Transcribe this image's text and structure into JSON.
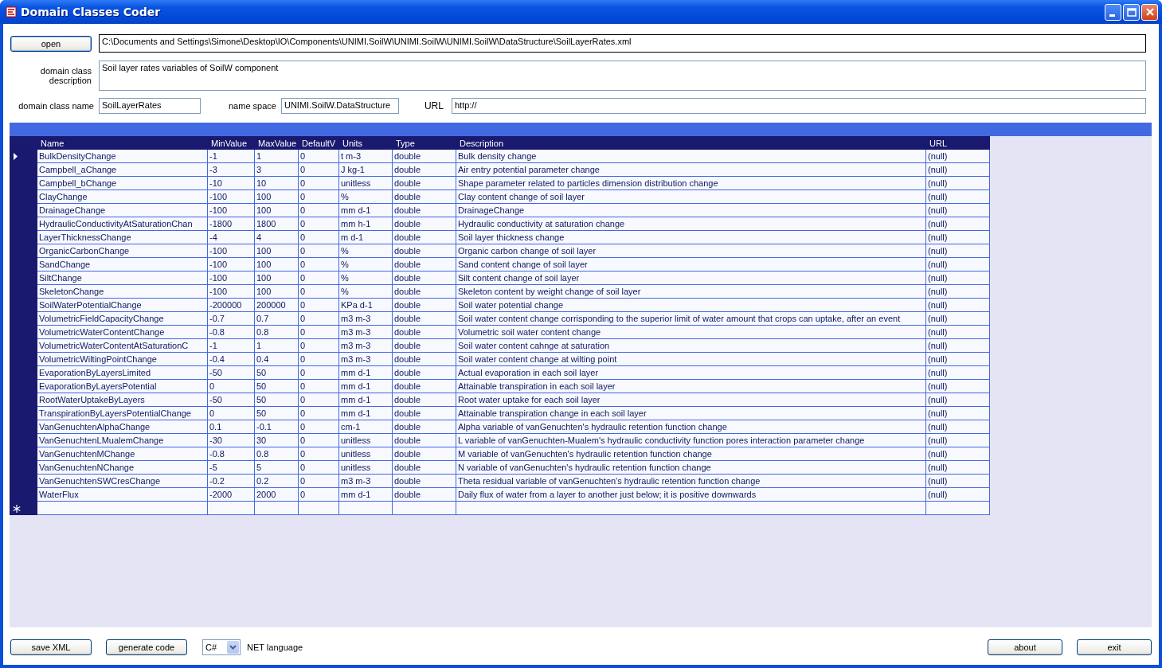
{
  "window": {
    "title": "Domain Classes Coder"
  },
  "open_button": "open",
  "file_path": "C:\\Documents and Settings\\Simone\\Desktop\\IO\\Components\\UNIMI.SoilW\\UNIMI.SoilW\\UNIMI.SoilW\\DataStructure\\SoilLayerRates.xml",
  "description": {
    "label": "domain class description",
    "value": "Soil layer rates variables of SoilW component"
  },
  "class_name": {
    "label": "domain class name",
    "value": "SoilLayerRates"
  },
  "name_space": {
    "label": "name space",
    "value": "UNIMI.SoilW.DataStructure"
  },
  "url": {
    "label": "URL",
    "value": "http://"
  },
  "table": {
    "columns": [
      "Name",
      "MinValue",
      "MaxValue",
      "DefaultV",
      "Units",
      "Type",
      "Description",
      "URL"
    ],
    "rows": [
      {
        "current": true,
        "cells": [
          "BulkDensityChange",
          "-1",
          "1",
          "0",
          "t m-3",
          "double",
          "Bulk density change",
          "(null)"
        ]
      },
      {
        "current": false,
        "cells": [
          "Campbell_aChange",
          "-3",
          "3",
          "0",
          "J kg-1",
          "double",
          "Air entry potential parameter change",
          "(null)"
        ]
      },
      {
        "current": false,
        "cells": [
          "Campbell_bChange",
          "-10",
          "10",
          "0",
          "unitless",
          "double",
          "Shape parameter related to particles dimension distribution change",
          "(null)"
        ]
      },
      {
        "current": false,
        "cells": [
          "ClayChange",
          "-100",
          "100",
          "0",
          "%",
          "double",
          "Clay content change of soil layer",
          "(null)"
        ]
      },
      {
        "current": false,
        "cells": [
          "DrainageChange",
          "-100",
          "100",
          "0",
          "mm d-1",
          "double",
          "DrainageChange",
          "(null)"
        ]
      },
      {
        "current": false,
        "cells": [
          "HydraulicConductivityAtSaturationChan",
          "-1800",
          "1800",
          "0",
          "mm h-1",
          "double",
          "Hydraulic conductivity at saturation change",
          "(null)"
        ]
      },
      {
        "current": false,
        "cells": [
          "LayerThicknessChange",
          "-4",
          "4",
          "0",
          "m d-1",
          "double",
          "Soil layer thickness change",
          "(null)"
        ]
      },
      {
        "current": false,
        "cells": [
          "OrganicCarbonChange",
          "-100",
          "100",
          "0",
          "%",
          "double",
          "Organic carbon change of soil layer",
          "(null)"
        ]
      },
      {
        "current": false,
        "cells": [
          "SandChange",
          "-100",
          "100",
          "0",
          "%",
          "double",
          "Sand content change of soil layer",
          "(null)"
        ]
      },
      {
        "current": false,
        "cells": [
          "SiltChange",
          "-100",
          "100",
          "0",
          "%",
          "double",
          "Silt content change of soil layer",
          "(null)"
        ]
      },
      {
        "current": false,
        "cells": [
          "SkeletonChange",
          "-100",
          "100",
          "0",
          "%",
          "double",
          "Skeleton content by weight change of soil layer",
          "(null)"
        ]
      },
      {
        "current": false,
        "cells": [
          "SoilWaterPotentialChange",
          "-200000",
          "200000",
          "0",
          "KPa d-1",
          "double",
          "Soil water potential change",
          "(null)"
        ]
      },
      {
        "current": false,
        "cells": [
          "VolumetricFieldCapacityChange",
          "-0.7",
          "0.7",
          "0",
          "m3 m-3",
          "double",
          "Soil water content change corrisponding to the superior limit of water amount that crops can uptake, after an event",
          "(null)"
        ]
      },
      {
        "current": false,
        "cells": [
          "VolumetricWaterContentChange",
          "-0.8",
          "0.8",
          "0",
          "m3 m-3",
          "double",
          "Volumetric soil water content change",
          "(null)"
        ]
      },
      {
        "current": false,
        "cells": [
          "VolumetricWaterContentAtSaturationC",
          "-1",
          "1",
          "0",
          "m3 m-3",
          "double",
          "Soil water content cahnge at saturation",
          "(null)"
        ]
      },
      {
        "current": false,
        "cells": [
          "VolumetricWiltingPointChange",
          "-0.4",
          "0.4",
          "0",
          "m3 m-3",
          "double",
          "Soil water content change at wilting point",
          "(null)"
        ]
      },
      {
        "current": false,
        "cells": [
          "EvaporationByLayersLimited",
          "-50",
          "50",
          "0",
          "mm d-1",
          "double",
          "Actual evaporation in each soil layer",
          "(null)"
        ]
      },
      {
        "current": false,
        "cells": [
          "EvaporationByLayersPotential",
          "0",
          "50",
          "0",
          "mm d-1",
          "double",
          "Attainable transpiration in each soil layer",
          "(null)"
        ]
      },
      {
        "current": false,
        "cells": [
          "RootWaterUptakeByLayers",
          "-50",
          "50",
          "0",
          "mm d-1",
          "double",
          "Root water uptake for each soil layer",
          "(null)"
        ]
      },
      {
        "current": false,
        "cells": [
          "TranspirationByLayersPotentialChange",
          "0",
          "50",
          "0",
          "mm d-1",
          "double",
          "Attainable transpiration change in each soil layer",
          "(null)"
        ]
      },
      {
        "current": false,
        "cells": [
          "VanGenuchtenAlphaChange",
          "0.1",
          "-0.1",
          "0",
          "cm-1",
          "double",
          "Alpha variable of vanGenuchten's hydraulic retention function change",
          "(null)"
        ]
      },
      {
        "current": false,
        "cells": [
          "VanGenuchtenLMualemChange",
          "-30",
          "30",
          "0",
          "unitless",
          "double",
          "L variable of vanGenuchten-Mualem's hydraulic conductivity function pores interaction parameter change",
          "(null)"
        ]
      },
      {
        "current": false,
        "cells": [
          "VanGenuchtenMChange",
          "-0.8",
          "0.8",
          "0",
          "unitless",
          "double",
          "M variable of vanGenuchten's hydraulic retention function change",
          "(null)"
        ]
      },
      {
        "current": false,
        "cells": [
          "VanGenuchtenNChange",
          "-5",
          "5",
          "0",
          "unitless",
          "double",
          "N variable of vanGenuchten's hydraulic retention function change",
          "(null)"
        ]
      },
      {
        "current": false,
        "cells": [
          "VanGenuchtenSWCresChange",
          "-0.2",
          "0.2",
          "0",
          "m3 m-3",
          "double",
          "Theta residual variable of vanGenuchten's hydraulic retention function change",
          "(null)"
        ]
      },
      {
        "current": false,
        "cells": [
          "WaterFlux",
          "-2000",
          "2000",
          "0",
          "mm d-1",
          "double",
          "Daily flux of water from a layer to another just below; it is positive downwards",
          "(null)"
        ]
      }
    ]
  },
  "buttons_left": [
    "save XML",
    "generate code"
  ],
  "language": {
    "value": "C#",
    "label": "NET language"
  },
  "buttons_right": [
    "about",
    "exit"
  ]
}
